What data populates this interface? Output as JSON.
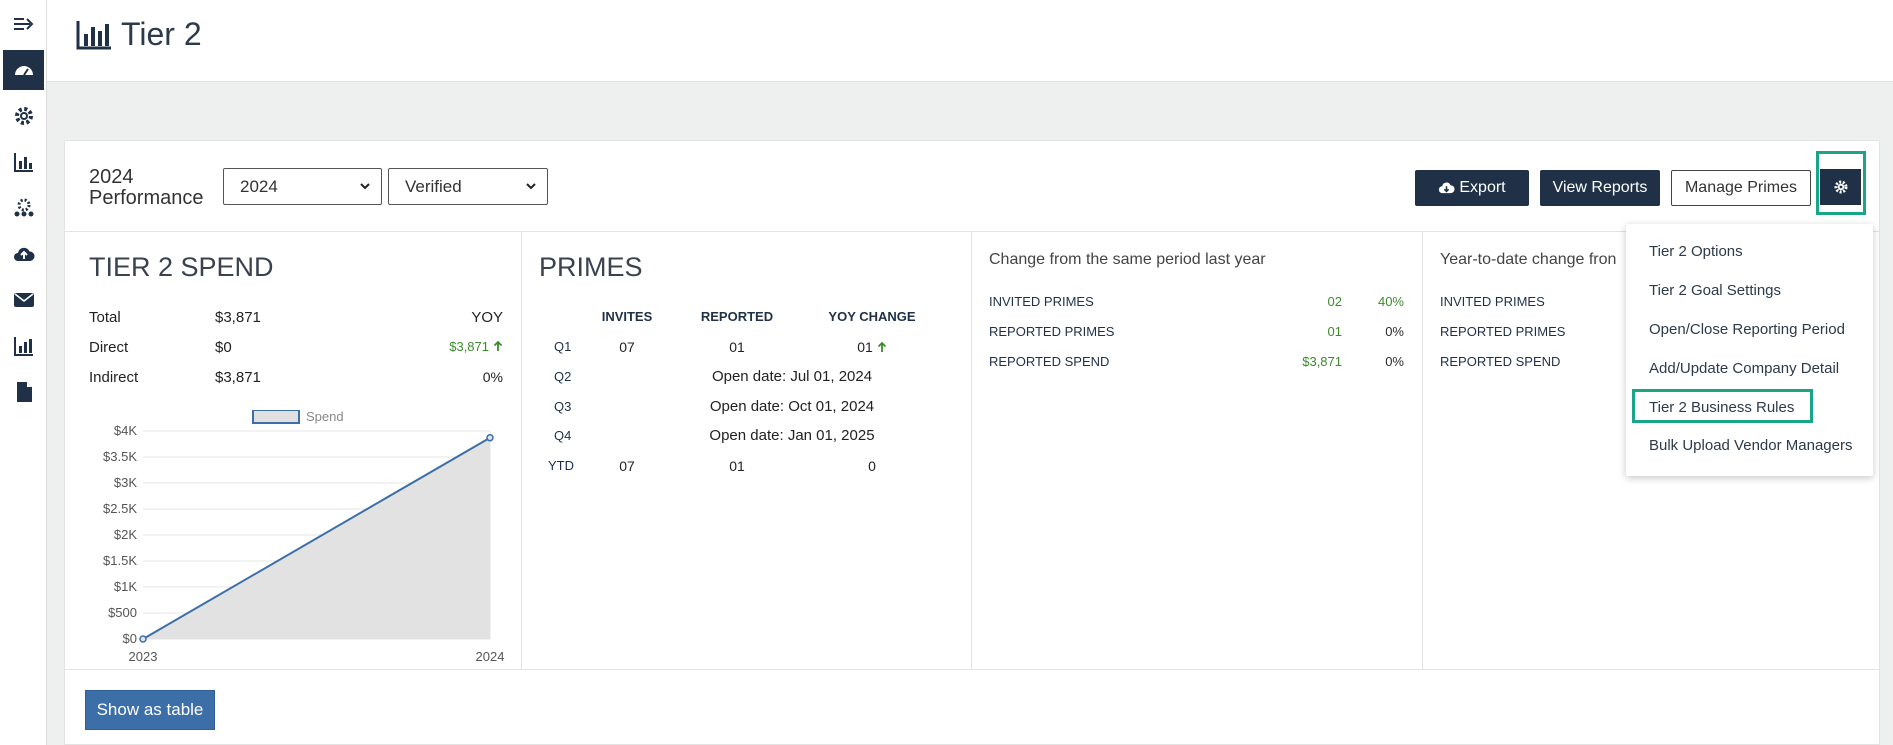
{
  "header": {
    "title": "Tier 2"
  },
  "sidebar": {
    "items": [
      {
        "icon": "expand-arrow-icon"
      },
      {
        "icon": "dashboard-gauge-icon",
        "active": true
      },
      {
        "icon": "gear-icon"
      },
      {
        "icon": "report-chart-icon"
      },
      {
        "icon": "team-settings-icon"
      },
      {
        "icon": "cloud-upload-icon"
      },
      {
        "icon": "envelope-icon"
      },
      {
        "icon": "analytics-icon"
      },
      {
        "icon": "document-icon"
      }
    ]
  },
  "toolbar": {
    "perf_line1": "2024",
    "perf_line2": "Performance",
    "year_select": "2024",
    "status_select": "Verified",
    "export_label": "Export",
    "view_reports_label": "View Reports",
    "manage_primes_label": "Manage Primes"
  },
  "spend": {
    "title": "TIER 2 SPEND",
    "yoy_header": "YOY",
    "rows": [
      {
        "label": "Total",
        "value": "$3,871",
        "yoy": ""
      },
      {
        "label": "Direct",
        "value": "$0",
        "yoy": "$3,871"
      },
      {
        "label": "Indirect",
        "value": "$3,871",
        "yoy": "0%"
      }
    ]
  },
  "primes": {
    "title": "PRIMES",
    "headers": [
      "INVITES",
      "REPORTED",
      "YOY CHANGE"
    ],
    "q1": {
      "label": "Q1",
      "invites": "07",
      "reported": "01",
      "yoy": "01"
    },
    "q2": {
      "label": "Q2",
      "note": "Open date: Jul 01, 2024"
    },
    "q3": {
      "label": "Q3",
      "note": "Open date: Oct 01, 2024"
    },
    "q4": {
      "label": "Q4",
      "note": "Open date: Jan 01, 2025"
    },
    "ytd": {
      "label": "YTD",
      "invites": "07",
      "reported": "01",
      "yoy": "0"
    }
  },
  "change_same_period": {
    "title": "Change from the same period last year",
    "rows": [
      {
        "label": "INVITED PRIMES",
        "value": "02",
        "pct": "40%"
      },
      {
        "label": "REPORTED PRIMES",
        "value": "01",
        "pct": "0%"
      },
      {
        "label": "REPORTED SPEND",
        "value": "$3,871",
        "pct": "0%"
      }
    ]
  },
  "change_ytd": {
    "title": "Year-to-date change fron",
    "rows": [
      {
        "label": "INVITED PRIMES"
      },
      {
        "label": "REPORTED PRIMES"
      },
      {
        "label": "REPORTED SPEND"
      }
    ]
  },
  "menu": {
    "items": [
      "Tier 2 Options",
      "Tier 2 Goal Settings",
      "Open/Close Reporting Period",
      "Add/Update Company Detail",
      "Tier 2 Business Rules",
      "Bulk Upload Vendor Managers"
    ],
    "highlighted_index": 4
  },
  "bottom": {
    "show_table_label": "Show as table"
  },
  "colors": {
    "navy": "#1f3047",
    "green": "#3b8b2a",
    "highlight": "#19a688",
    "button_blue": "#3c6ea8"
  },
  "chart_data": {
    "type": "area",
    "legend": [
      "Spend"
    ],
    "categories": [
      "2023",
      "2024"
    ],
    "series": [
      {
        "name": "Spend",
        "values": [
          0,
          3871
        ]
      }
    ],
    "yticks": [
      "$0",
      "$500",
      "$1K",
      "$1.5K",
      "$2K",
      "$2.5K",
      "$3K",
      "$3.5K",
      "$4K"
    ],
    "ylim": [
      0,
      4000
    ],
    "grid": true
  }
}
